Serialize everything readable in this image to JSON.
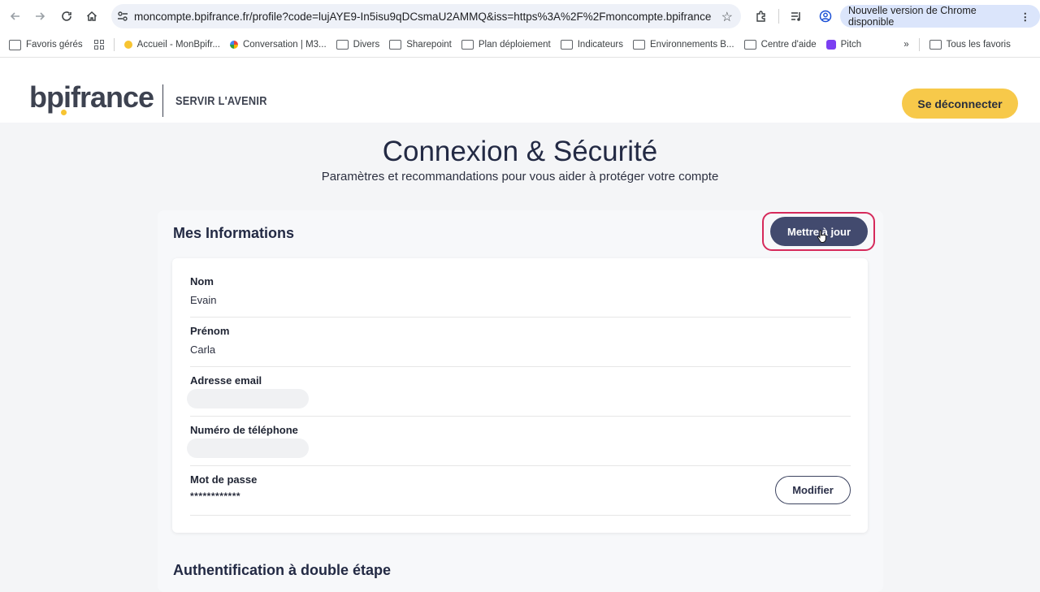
{
  "browser": {
    "url": "moncompte.bpifrance.fr/profile?code=lujAYE9-In5isu9qDCsmaU2AMMQ&iss=https%3A%2F%2Fmoncompte.bpifrance.f...",
    "update_chip": "Nouvelle version de Chrome disponible",
    "bookmarks": [
      "Favoris gérés",
      "Accueil - MonBpifr...",
      "Conversation | M3...",
      "Divers",
      "Sharepoint",
      "Plan déploiement",
      "Indicateurs",
      "Environnements B...",
      "Centre d'aide",
      "Pitch",
      "Tous les favoris"
    ]
  },
  "header": {
    "logo": "bpifrance",
    "tagline": "SERVIR L'AVENIR",
    "logout_label": "Se déconnecter"
  },
  "page": {
    "title": "Connexion & Sécurité",
    "subtitle": "Paramètres et recommandations pour vous aider à protéger votre compte"
  },
  "info": {
    "section_title": "Mes Informations",
    "update_label": "Mettre à jour",
    "fields": [
      {
        "label": "Nom",
        "value": "Evain"
      },
      {
        "label": "Prénom",
        "value": "Carla"
      },
      {
        "label": "Adresse email",
        "value": ""
      },
      {
        "label": "Numéro de téléphone",
        "value": ""
      },
      {
        "label": "Mot de passe",
        "value": "************"
      }
    ],
    "modify_label": "Modifier"
  },
  "twofa": {
    "section_title": "Authentification à double étape"
  },
  "colors": {
    "brand_yellow": "#f7c94a",
    "primary_button": "#424a6e",
    "highlight": "#d62a5b"
  }
}
